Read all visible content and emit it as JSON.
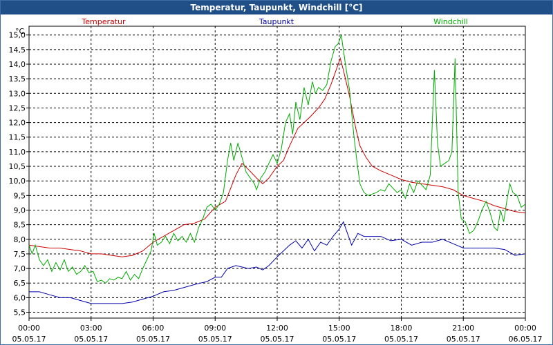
{
  "window": {
    "title": "Temperatur, Taupunkt, Windchill [°C]"
  },
  "colors": {
    "titlebar": "#1f4f86",
    "temperatur": "#cc0000",
    "taupunkt": "#0000aa",
    "windchill": "#00aa00"
  },
  "chart_data": {
    "type": "line",
    "title": "Temperatur, Taupunkt, Windchill [°C]",
    "ylabel": "°C",
    "xlabel": "",
    "ylim": [
      5.3,
      15.3
    ],
    "xlim_hours": [
      0,
      24
    ],
    "grid": true,
    "legend_placement": "top",
    "y_ticks": [
      "5,5",
      "6,0",
      "6,5",
      "7,0",
      "7,5",
      "8,0",
      "8,5",
      "9,0",
      "9,5",
      "10,0",
      "10,5",
      "11,0",
      "11,5",
      "12,0",
      "12,5",
      "13,0",
      "13,5",
      "14,0",
      "14,5",
      "15,0"
    ],
    "x_ticks": [
      {
        "time": "00:00",
        "date": "05.05.17"
      },
      {
        "time": "03:00",
        "date": "05.05.17"
      },
      {
        "time": "06:00",
        "date": "05.05.17"
      },
      {
        "time": "09:00",
        "date": "05.05.17"
      },
      {
        "time": "12:00",
        "date": "05.05.17"
      },
      {
        "time": "15:00",
        "date": "05.05.17"
      },
      {
        "time": "18:00",
        "date": "05.05.17"
      },
      {
        "time": "21:00",
        "date": "05.05.17"
      },
      {
        "time": "00:00",
        "date": "06.05.17"
      }
    ],
    "series": [
      {
        "name": "Temperatur",
        "color": "#cc0000",
        "points": [
          [
            0,
            7.8
          ],
          [
            0.5,
            7.75
          ],
          [
            1,
            7.7
          ],
          [
            1.5,
            7.7
          ],
          [
            2,
            7.65
          ],
          [
            2.5,
            7.6
          ],
          [
            3,
            7.5
          ],
          [
            3.5,
            7.5
          ],
          [
            4,
            7.45
          ],
          [
            4.5,
            7.4
          ],
          [
            5,
            7.45
          ],
          [
            5.5,
            7.6
          ],
          [
            6,
            7.9
          ],
          [
            6.5,
            8.1
          ],
          [
            7,
            8.3
          ],
          [
            7.5,
            8.5
          ],
          [
            8,
            8.55
          ],
          [
            8.5,
            8.7
          ],
          [
            9,
            9.1
          ],
          [
            9.5,
            9.3
          ],
          [
            10,
            10.2
          ],
          [
            10.3,
            10.6
          ],
          [
            10.6,
            10.4
          ],
          [
            11,
            10.1
          ],
          [
            11.3,
            9.9
          ],
          [
            11.6,
            10.1
          ],
          [
            12,
            10.5
          ],
          [
            12.3,
            10.7
          ],
          [
            12.6,
            11.2
          ],
          [
            13,
            11.8
          ],
          [
            13.3,
            12.0
          ],
          [
            13.6,
            12.2
          ],
          [
            14,
            12.5
          ],
          [
            14.3,
            12.8
          ],
          [
            14.6,
            13.3
          ],
          [
            14.9,
            13.9
          ],
          [
            15.05,
            14.2
          ],
          [
            15.2,
            13.8
          ],
          [
            15.5,
            12.9
          ],
          [
            15.8,
            11.8
          ],
          [
            16,
            11.2
          ],
          [
            16.3,
            10.8
          ],
          [
            16.6,
            10.5
          ],
          [
            17,
            10.35
          ],
          [
            17.5,
            10.2
          ],
          [
            18,
            10.05
          ],
          [
            18.5,
            9.95
          ],
          [
            19,
            9.9
          ],
          [
            19.5,
            9.85
          ],
          [
            20,
            9.8
          ],
          [
            20.5,
            9.7
          ],
          [
            21,
            9.5
          ],
          [
            21.5,
            9.4
          ],
          [
            22,
            9.3
          ],
          [
            22.5,
            9.15
          ],
          [
            23,
            9.05
          ],
          [
            23.5,
            8.95
          ],
          [
            24,
            8.9
          ]
        ]
      },
      {
        "name": "Taupunkt",
        "color": "#0000aa",
        "points": [
          [
            0,
            6.2
          ],
          [
            0.5,
            6.2
          ],
          [
            1,
            6.1
          ],
          [
            1.5,
            6.0
          ],
          [
            2,
            6.0
          ],
          [
            2.5,
            5.9
          ],
          [
            3,
            5.8
          ],
          [
            3.5,
            5.8
          ],
          [
            4,
            5.8
          ],
          [
            4.5,
            5.8
          ],
          [
            5,
            5.85
          ],
          [
            5.5,
            5.95
          ],
          [
            6,
            6.05
          ],
          [
            6.5,
            6.2
          ],
          [
            7,
            6.25
          ],
          [
            7.5,
            6.35
          ],
          [
            8,
            6.45
          ],
          [
            8.3,
            6.5
          ],
          [
            8.6,
            6.55
          ],
          [
            9,
            6.7
          ],
          [
            9.3,
            6.7
          ],
          [
            9.6,
            7.0
          ],
          [
            10,
            7.1
          ],
          [
            10.3,
            7.05
          ],
          [
            10.6,
            7.0
          ],
          [
            11,
            7.05
          ],
          [
            11.3,
            6.95
          ],
          [
            11.6,
            7.1
          ],
          [
            12,
            7.4
          ],
          [
            12.3,
            7.6
          ],
          [
            12.6,
            7.8
          ],
          [
            12.9,
            7.95
          ],
          [
            13.2,
            7.7
          ],
          [
            13.5,
            8.0
          ],
          [
            13.8,
            7.6
          ],
          [
            14.1,
            7.9
          ],
          [
            14.4,
            7.8
          ],
          [
            14.7,
            8.1
          ],
          [
            15.0,
            8.35
          ],
          [
            15.2,
            8.6
          ],
          [
            15.4,
            8.2
          ],
          [
            15.6,
            7.8
          ],
          [
            15.9,
            8.2
          ],
          [
            16.2,
            8.1
          ],
          [
            16.6,
            8.1
          ],
          [
            17,
            8.1
          ],
          [
            17.5,
            7.95
          ],
          [
            18,
            8.0
          ],
          [
            18.5,
            7.8
          ],
          [
            19,
            7.9
          ],
          [
            19.5,
            7.9
          ],
          [
            20,
            8.0
          ],
          [
            20.5,
            7.85
          ],
          [
            21,
            7.7
          ],
          [
            21.5,
            7.7
          ],
          [
            22,
            7.7
          ],
          [
            22.5,
            7.7
          ],
          [
            23,
            7.65
          ],
          [
            23.5,
            7.45
          ],
          [
            24,
            7.5
          ]
        ]
      },
      {
        "name": "Windchill",
        "color": "#00aa00",
        "points": [
          [
            0,
            7.8
          ],
          [
            0.15,
            7.5
          ],
          [
            0.3,
            7.8
          ],
          [
            0.5,
            7.3
          ],
          [
            0.7,
            7.1
          ],
          [
            0.9,
            7.3
          ],
          [
            1.1,
            6.9
          ],
          [
            1.3,
            7.2
          ],
          [
            1.5,
            6.95
          ],
          [
            1.7,
            7.3
          ],
          [
            1.9,
            6.9
          ],
          [
            2.1,
            7.05
          ],
          [
            2.3,
            6.8
          ],
          [
            2.5,
            6.9
          ],
          [
            2.7,
            7.1
          ],
          [
            2.9,
            6.85
          ],
          [
            3.1,
            6.9
          ],
          [
            3.3,
            6.55
          ],
          [
            3.5,
            6.6
          ],
          [
            3.7,
            6.5
          ],
          [
            3.9,
            6.65
          ],
          [
            4.1,
            6.6
          ],
          [
            4.3,
            6.7
          ],
          [
            4.5,
            6.65
          ],
          [
            4.7,
            6.9
          ],
          [
            4.9,
            6.6
          ],
          [
            5.1,
            6.8
          ],
          [
            5.3,
            6.65
          ],
          [
            5.5,
            7.0
          ],
          [
            5.7,
            7.3
          ],
          [
            5.9,
            7.6
          ],
          [
            6.05,
            8.2
          ],
          [
            6.2,
            7.8
          ],
          [
            6.4,
            7.9
          ],
          [
            6.6,
            8.1
          ],
          [
            6.8,
            7.85
          ],
          [
            7.0,
            8.2
          ],
          [
            7.2,
            7.95
          ],
          [
            7.4,
            8.1
          ],
          [
            7.6,
            7.9
          ],
          [
            7.8,
            8.2
          ],
          [
            8.0,
            7.9
          ],
          [
            8.2,
            8.4
          ],
          [
            8.4,
            8.7
          ],
          [
            8.6,
            9.1
          ],
          [
            8.8,
            9.2
          ],
          [
            9.0,
            9.0
          ],
          [
            9.2,
            9.2
          ],
          [
            9.4,
            9.6
          ],
          [
            9.6,
            10.7
          ],
          [
            9.75,
            11.3
          ],
          [
            9.9,
            10.7
          ],
          [
            10.1,
            11.3
          ],
          [
            10.3,
            10.8
          ],
          [
            10.5,
            10.3
          ],
          [
            10.7,
            10.1
          ],
          [
            10.9,
            9.9
          ],
          [
            11.0,
            9.7
          ],
          [
            11.2,
            10.1
          ],
          [
            11.4,
            10.3
          ],
          [
            11.6,
            10.6
          ],
          [
            11.8,
            10.9
          ],
          [
            12.0,
            10.6
          ],
          [
            12.2,
            11.1
          ],
          [
            12.4,
            12.0
          ],
          [
            12.6,
            12.3
          ],
          [
            12.75,
            11.6
          ],
          [
            12.9,
            12.7
          ],
          [
            13.1,
            12.1
          ],
          [
            13.3,
            13.2
          ],
          [
            13.5,
            12.6
          ],
          [
            13.7,
            13.4
          ],
          [
            13.85,
            13.0
          ],
          [
            14.0,
            13.2
          ],
          [
            14.2,
            13.1
          ],
          [
            14.4,
            13.3
          ],
          [
            14.6,
            14.1
          ],
          [
            14.8,
            14.6
          ],
          [
            14.95,
            14.7
          ],
          [
            15.1,
            15.0
          ],
          [
            15.3,
            14.0
          ],
          [
            15.5,
            13.1
          ],
          [
            15.7,
            11.6
          ],
          [
            15.85,
            10.7
          ],
          [
            16.0,
            9.9
          ],
          [
            16.2,
            9.6
          ],
          [
            16.4,
            9.5
          ],
          [
            16.6,
            9.55
          ],
          [
            16.8,
            9.6
          ],
          [
            17.0,
            9.7
          ],
          [
            17.2,
            9.65
          ],
          [
            17.4,
            9.9
          ],
          [
            17.6,
            9.75
          ],
          [
            17.8,
            9.6
          ],
          [
            18.0,
            9.7
          ],
          [
            18.2,
            9.4
          ],
          [
            18.4,
            9.9
          ],
          [
            18.6,
            9.6
          ],
          [
            18.8,
            10.0
          ],
          [
            19.0,
            9.85
          ],
          [
            19.2,
            9.7
          ],
          [
            19.4,
            10.2
          ],
          [
            19.6,
            13.8
          ],
          [
            19.75,
            11.3
          ],
          [
            19.9,
            10.5
          ],
          [
            20.1,
            10.6
          ],
          [
            20.3,
            10.7
          ],
          [
            20.45,
            11.0
          ],
          [
            20.6,
            14.2
          ],
          [
            20.75,
            9.6
          ],
          [
            20.9,
            8.7
          ],
          [
            21.1,
            8.6
          ],
          [
            21.3,
            8.2
          ],
          [
            21.5,
            8.3
          ],
          [
            21.7,
            8.6
          ],
          [
            21.9,
            9.0
          ],
          [
            22.1,
            9.3
          ],
          [
            22.3,
            8.9
          ],
          [
            22.5,
            8.4
          ],
          [
            22.65,
            8.3
          ],
          [
            22.8,
            9.0
          ],
          [
            22.95,
            8.6
          ],
          [
            23.1,
            9.3
          ],
          [
            23.25,
            9.9
          ],
          [
            23.4,
            9.6
          ],
          [
            23.6,
            9.5
          ],
          [
            23.8,
            9.1
          ],
          [
            24.0,
            9.2
          ]
        ]
      }
    ]
  }
}
